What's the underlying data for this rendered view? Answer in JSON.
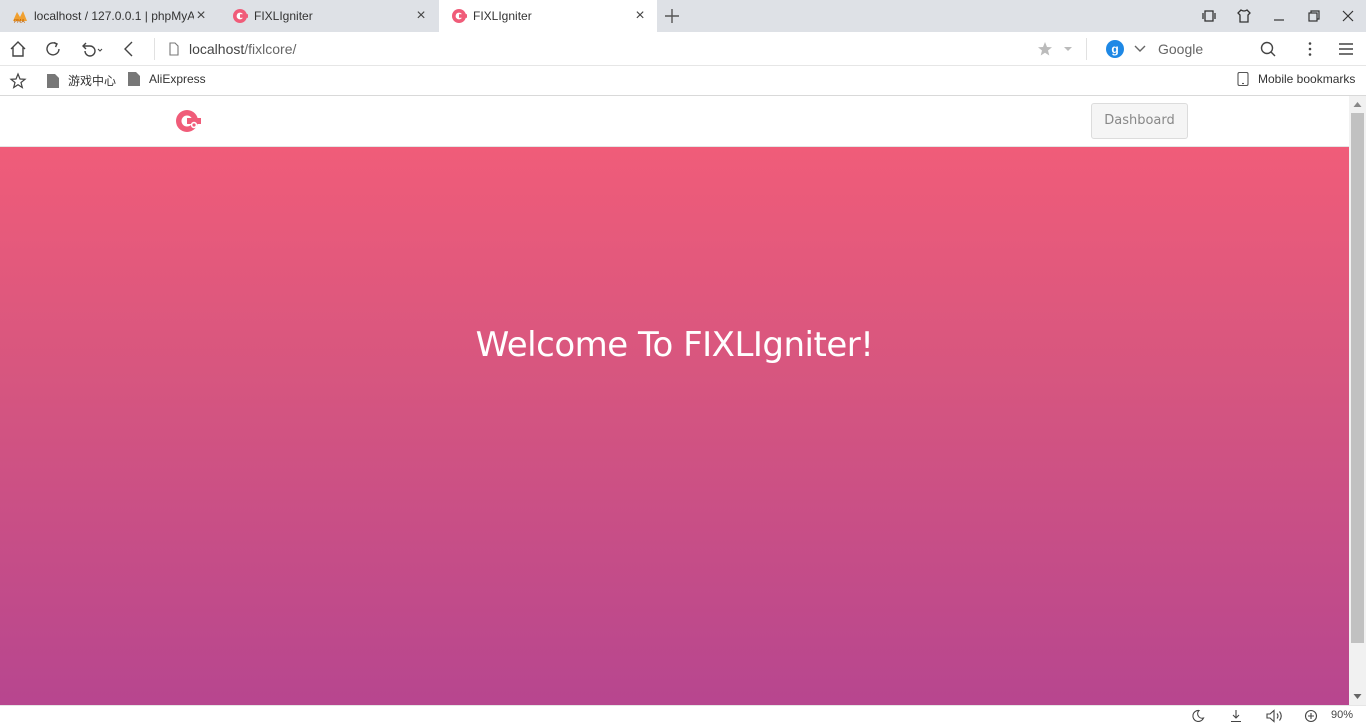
{
  "tabs": [
    {
      "title": "localhost / 127.0.0.1 | phpMyA",
      "favicon": "phpmyadmin-icon"
    },
    {
      "title": "FIXLIgniter",
      "favicon": "fixligniter-icon"
    },
    {
      "title": "FIXLIgniter",
      "favicon": "fixligniter-icon",
      "active": true
    }
  ],
  "address_bar": {
    "host": "localhost",
    "path": "/fixlcore/"
  },
  "search": {
    "engine_badge": "g",
    "engine_name": "Google"
  },
  "bookmarks": {
    "items": [
      {
        "label": "游戏中心"
      },
      {
        "label": "AliExpress"
      }
    ],
    "mobile_label": "Mobile bookmarks"
  },
  "page": {
    "nav": {
      "dashboard_label": "Dashboard"
    },
    "hero": {
      "heading": "Welcome To FIXLIgniter!"
    }
  },
  "status_bar": {
    "zoom": "90%"
  },
  "colors": {
    "brand": "#f05c79",
    "gradient_top": "#f05c79",
    "gradient_bottom": "#b7468f"
  }
}
